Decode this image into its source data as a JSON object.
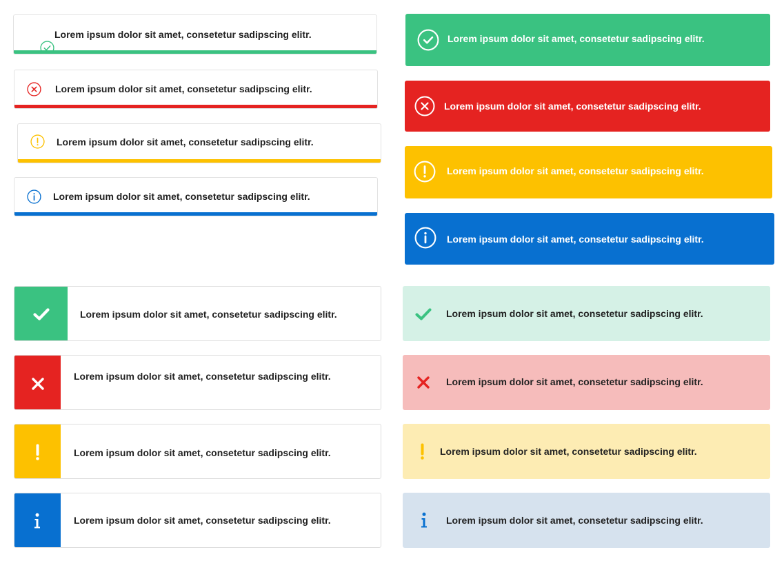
{
  "message": "Lorem ipsum dolor sit amet, consetetur sadipscing elitr.",
  "colors": {
    "success": "#3ac281",
    "error": "#e52321",
    "warning": "#fdc100",
    "info": "#0870d0",
    "success_tint": "#d5f1e6",
    "error_tint": "#f6bcbb",
    "warning_tint": "#fdecb3",
    "info_tint": "#d6e2ee"
  },
  "icons": {
    "success": "check-circle-icon",
    "error": "x-circle-icon",
    "warning": "exclamation-circle-icon",
    "info": "info-circle-icon"
  },
  "alerts": {
    "bar": [
      {
        "type": "success",
        "text": "Lorem ipsum dolor sit amet, consetetur sadipscing elitr."
      },
      {
        "type": "error",
        "text": "Lorem ipsum dolor sit amet, consetetur sadipscing elitr."
      },
      {
        "type": "warning",
        "text": "Lorem ipsum dolor sit amet, consetetur sadipscing elitr."
      },
      {
        "type": "info",
        "text": "Lorem ipsum dolor sit amet, consetetur sadipscing elitr."
      }
    ],
    "solid": [
      {
        "type": "success",
        "text": "Lorem ipsum dolor sit amet, consetetur sadipscing elitr."
      },
      {
        "type": "error",
        "text": "Lorem ipsum dolor sit amet, consetetur sadipscing elitr."
      },
      {
        "type": "warning",
        "text": "Lorem ipsum dolor sit amet, consetetur sadipscing elitr."
      },
      {
        "type": "info",
        "text": "Lorem ipsum dolor sit amet, consetetur sadipscing elitr."
      }
    ],
    "block": [
      {
        "type": "success",
        "text": "Lorem ipsum dolor sit amet, consetetur sadipscing elitr."
      },
      {
        "type": "error",
        "text": "Lorem ipsum dolor sit amet, consetetur sadipscing elitr."
      },
      {
        "type": "warning",
        "text": "Lorem ipsum dolor sit amet, consetetur sadipscing elitr."
      },
      {
        "type": "info",
        "text": "Lorem ipsum dolor sit amet, consetetur sadipscing elitr."
      }
    ],
    "tint": [
      {
        "type": "success",
        "text": "Lorem ipsum dolor sit amet, consetetur sadipscing elitr."
      },
      {
        "type": "error",
        "text": "Lorem ipsum dolor sit amet, consetetur sadipscing elitr."
      },
      {
        "type": "warning",
        "text": "Lorem ipsum dolor sit amet, consetetur sadipscing elitr."
      },
      {
        "type": "info",
        "text": "Lorem ipsum dolor sit amet, consetetur sadipscing elitr."
      }
    ]
  }
}
